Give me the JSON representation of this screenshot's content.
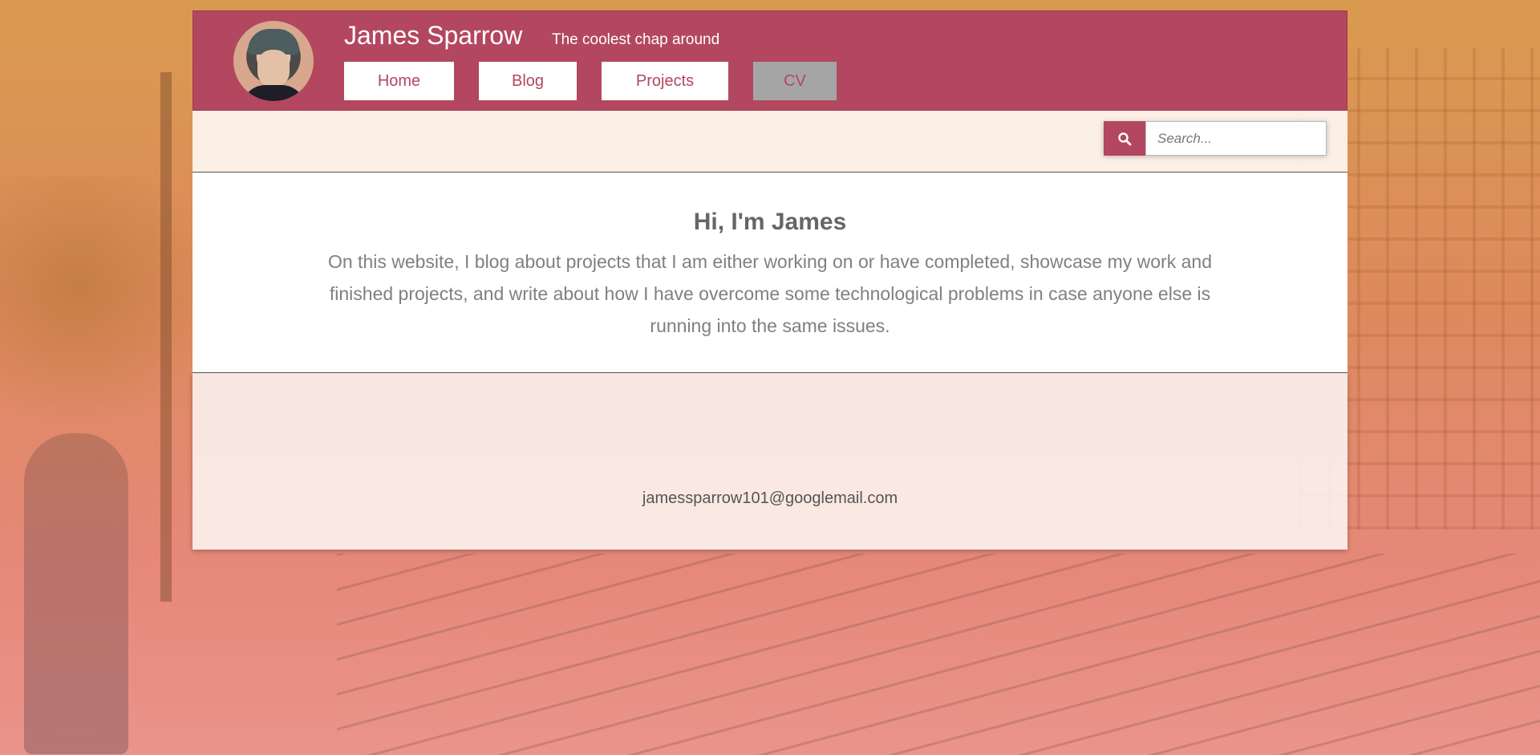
{
  "header": {
    "title": "James Sparrow",
    "tagline": "The coolest chap around",
    "nav": [
      {
        "label": "Home"
      },
      {
        "label": "Blog"
      },
      {
        "label": "Projects"
      },
      {
        "label": "CV"
      }
    ],
    "active_nav": "CV"
  },
  "search": {
    "placeholder": "Search...",
    "icon": "search-icon"
  },
  "hero": {
    "heading": "Hi, I'm James",
    "body": "On this website, I blog about projects that I am either working on or have completed, showcase my work and finished projects, and write about how I have overcome some technological problems in case anyone else is running into the same issues."
  },
  "footer": {
    "email": "jamessparrow101@googlemail.com"
  },
  "colors": {
    "brand": "#b3475f",
    "nav_active_bg": "#a6a5a6"
  }
}
